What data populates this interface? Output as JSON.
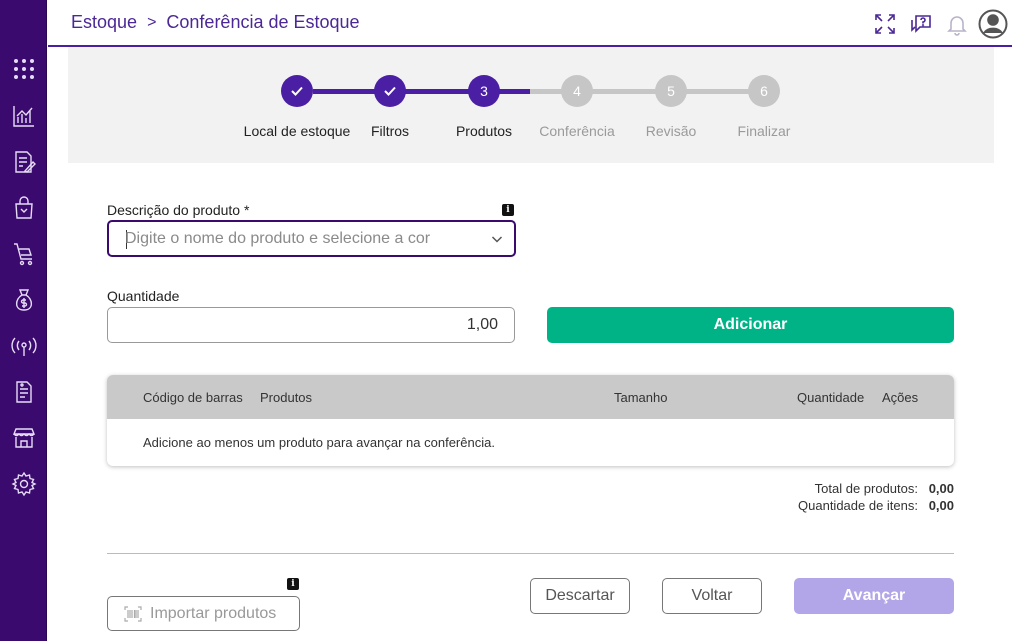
{
  "colors": {
    "sidebar_bg": "#3b0a6e",
    "accent_purple": "#4b2896",
    "step_done": "#4b1fa3",
    "step_pending": "#c6c6c6",
    "add_button": "#00b386",
    "next_button_disabled": "#b3a6e8"
  },
  "sidebar": {
    "items": [
      {
        "icon": "apps-grid-icon"
      },
      {
        "icon": "chart-icon"
      },
      {
        "icon": "document-edit-icon"
      },
      {
        "icon": "shopping-bag-icon"
      },
      {
        "icon": "cart-icon"
      },
      {
        "icon": "money-bag-icon"
      },
      {
        "icon": "broadcast-icon"
      },
      {
        "icon": "report-icon"
      },
      {
        "icon": "store-icon"
      },
      {
        "icon": "settings-gear-icon"
      }
    ]
  },
  "header": {
    "breadcrumb_root": "Estoque",
    "breadcrumb_separator": ">",
    "breadcrumb_current": "Conferência de Estoque",
    "icons": [
      "fullscreen-icon",
      "help-chat-icon",
      "bell-icon",
      "user-avatar-icon"
    ]
  },
  "stepper": {
    "steps": [
      {
        "number": "1",
        "label": "Local de estoque",
        "state": "done"
      },
      {
        "number": "2",
        "label": "Filtros",
        "state": "done"
      },
      {
        "number": "3",
        "label": "Produtos",
        "state": "current"
      },
      {
        "number": "4",
        "label": "Conferência",
        "state": "pending"
      },
      {
        "number": "5",
        "label": "Revisão",
        "state": "pending"
      },
      {
        "number": "6",
        "label": "Finalizar",
        "state": "pending"
      }
    ]
  },
  "form": {
    "product_label": "Descrição do produto *",
    "product_placeholder": "Digite o nome do produto e selecione a cor",
    "product_value": "",
    "quantity_label": "Quantidade",
    "quantity_value": "1,00",
    "add_button": "Adicionar",
    "info_badge": "i"
  },
  "table": {
    "columns": [
      "Código de barras",
      "Produtos",
      "Tamanho",
      "Quantidade",
      "Ações"
    ],
    "rows": [],
    "empty_message": "Adicione ao menos um produto para avançar na conferência."
  },
  "totals": {
    "total_products_label": "Total de produtos:",
    "total_products_value": "0,00",
    "total_items_label": "Quantidade de itens:",
    "total_items_value": "0,00"
  },
  "footer": {
    "import_button": "Importar produtos",
    "discard_button": "Descartar",
    "back_button": "Voltar",
    "next_button": "Avançar"
  }
}
